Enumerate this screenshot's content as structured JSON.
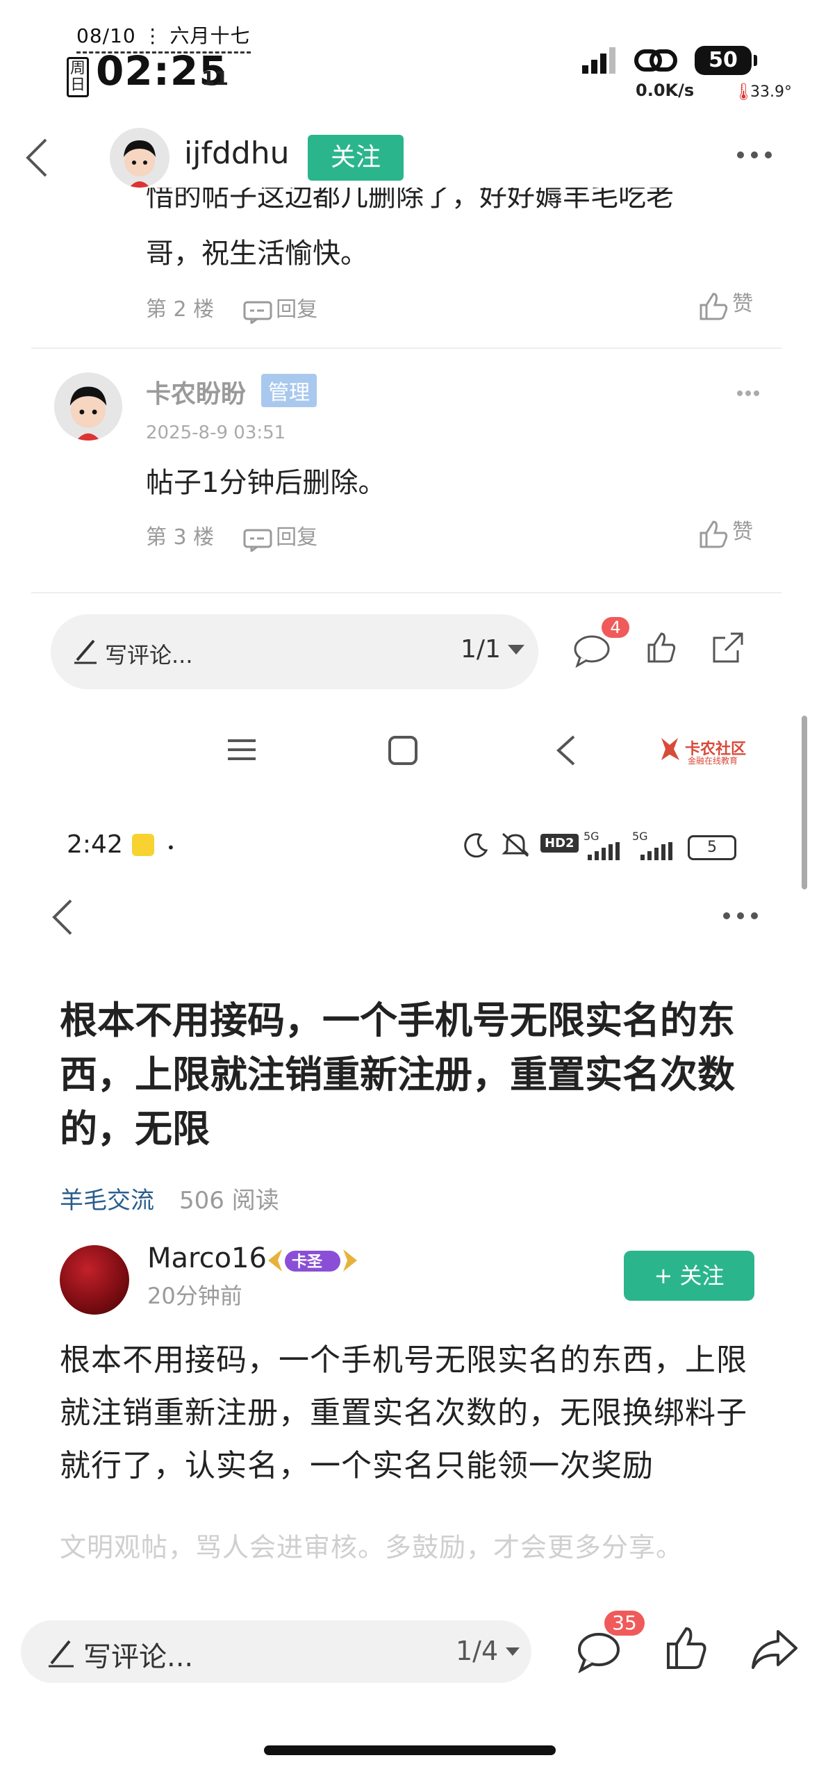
{
  "status_bar_top": {
    "date": "08/10",
    "lunar_date": "六月十七",
    "weekday": "周日",
    "time": "02:25",
    "seconds": "11",
    "battery": "50",
    "net_speed": "0.0K/s",
    "temperature": "33.9°"
  },
  "thread_header": {
    "username": "ijfddhu",
    "follow_label": "关注"
  },
  "comments": [
    {
      "partial_text_line1": "惜的帖子这边都几删除了，好好薅羊毛吃老",
      "text_line2": "哥，祝生活愉快。",
      "floor": "第 2 楼",
      "reply_label": "回复",
      "like_label": "赞"
    },
    {
      "author": "卡农盼盼",
      "role_badge": "管理",
      "time": "2025-8-9 03:51",
      "text": "帖子1分钟后删除。",
      "floor": "第 3 楼",
      "reply_label": "回复",
      "like_label": "赞"
    }
  ],
  "comment_bar_top": {
    "placeholder": "写评论...",
    "page_indicator": "1/1",
    "comment_count": "4"
  },
  "watermark": {
    "brand": "卡农社区",
    "tagline": "金融在线教育"
  },
  "status_bar_inner": {
    "time": "2:42",
    "hd_label": "HD2",
    "network1": "5G",
    "network2": "5G",
    "battery": "5"
  },
  "post": {
    "title": "根本不用接码，一个手机号无限实名的东西，上限就注销重新注册，重置实名次数的，无限",
    "category": "羊毛交流",
    "reads": "506 阅读",
    "author": "Marco16",
    "author_badge": "卡圣",
    "time_ago": "20分钟前",
    "follow_label": "关注",
    "body": "根本不用接码，一个手机号无限实名的东西，上限就注销重新注册，重置实名次数的，无限换绑料子就行了，认实名，一个实名只能领一次奖励",
    "hint": "文明观帖，骂人会进审核。多鼓励，才会更多分享。"
  },
  "comment_bar_bottom": {
    "placeholder": "写评论...",
    "page_indicator": "1/4",
    "comment_count": "35"
  },
  "colors": {
    "accent_green": "#2bb58c",
    "badge_red": "#f05a5a",
    "link_blue": "#2a5d8c",
    "admin_badge": "#a9c8ee"
  }
}
